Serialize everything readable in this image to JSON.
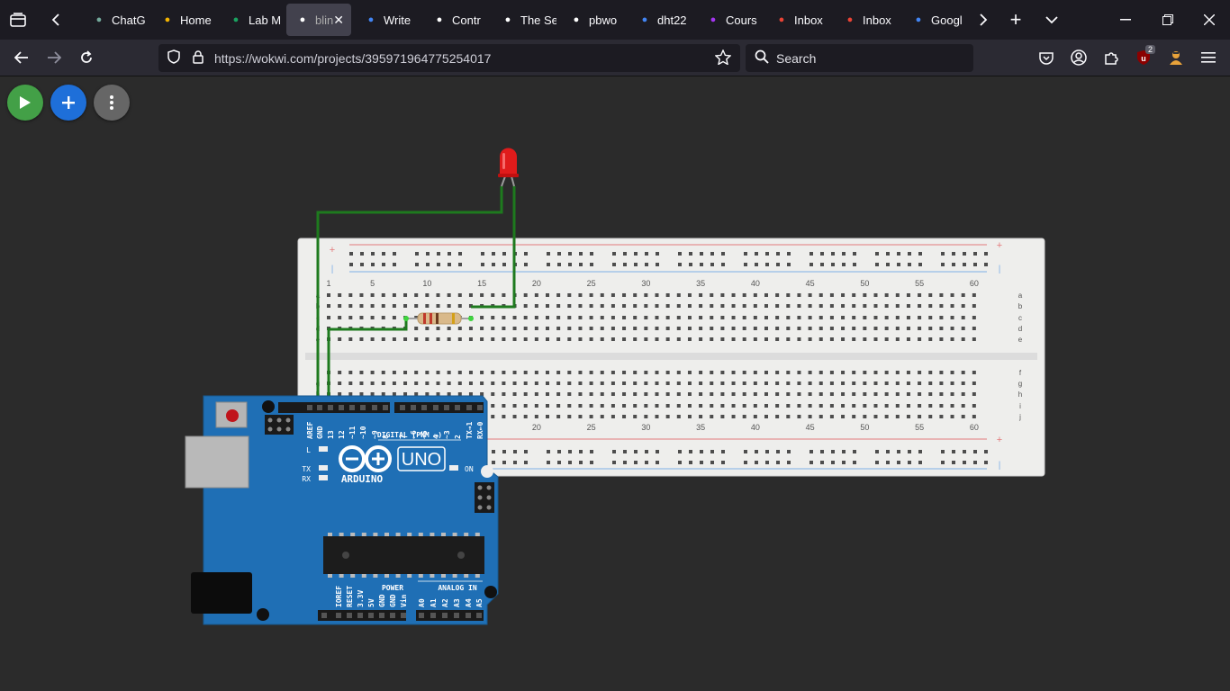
{
  "browser": {
    "tabs": [
      {
        "label": "ChatG",
        "icon": "chatgpt-icon",
        "color": "#74aa9c"
      },
      {
        "label": "Home",
        "icon": "home-icon",
        "color": "#f4b400"
      },
      {
        "label": "Lab M",
        "icon": "classroom-icon",
        "color": "#1aa260"
      },
      {
        "label": "blin",
        "icon": "wokwi-icon",
        "color": "#ffffff",
        "active": true
      },
      {
        "label": "Write",
        "icon": "google-icon",
        "color": "#4285f4"
      },
      {
        "label": "Contr",
        "icon": "medium-icon",
        "color": "#ffffff"
      },
      {
        "label": "The Se",
        "icon": "wokwi-icon",
        "color": "#ffffff"
      },
      {
        "label": "pbwo",
        "icon": "github-icon",
        "color": "#ffffff"
      },
      {
        "label": "dht22",
        "icon": "google-icon",
        "color": "#4285f4"
      },
      {
        "label": "Cours",
        "icon": "udemy-icon",
        "color": "#a435f0"
      },
      {
        "label": "Inbox",
        "icon": "gmail-icon",
        "color": "#ea4335"
      },
      {
        "label": "Inbox",
        "icon": "gmail-icon",
        "color": "#ea4335"
      },
      {
        "label": "Googl",
        "icon": "google-icon",
        "color": "#4285f4"
      }
    ],
    "url": "https://wokwi.com/projects/395971964775254017",
    "search_placeholder": "Search",
    "extension_badge": "2"
  },
  "toolbar": {
    "colors": {
      "play": "#43a047",
      "add": "#1e6fd9",
      "more": "#666666"
    }
  },
  "circuit": {
    "colors": {
      "board": "#1f6fb5",
      "breadboard": "#eeeeec",
      "wire": "#1e7a1e",
      "led": "#e01b1b"
    },
    "breadboard": {
      "column_labels": [
        "1",
        "5",
        "10",
        "15",
        "20",
        "25",
        "30",
        "35",
        "40",
        "45",
        "50",
        "55",
        "60"
      ],
      "top_rows": [
        "a",
        "b",
        "c",
        "d",
        "e"
      ],
      "bottom_rows": [
        "f",
        "g",
        "h",
        "i",
        "j"
      ],
      "plus": "+",
      "minus": "-"
    },
    "arduino": {
      "model": "UNO",
      "brand": "ARDUINO",
      "digital_label": "DIGITAL (PWM ~)",
      "digital_pins": [
        "AREF",
        "GND",
        "13",
        "12",
        "~11",
        "~10",
        "~9",
        "8",
        "7",
        "~6",
        "~5",
        "4",
        "~3",
        "2",
        "TX→1",
        "RX←0"
      ],
      "power_pins": [
        "IOREF",
        "RESET",
        "3.3V",
        "5V",
        "GND",
        "GND",
        "Vin"
      ],
      "power_label": "POWER",
      "analog_label": "ANALOG IN",
      "analog_pins": [
        "A0",
        "A1",
        "A2",
        "A3",
        "A4",
        "A5"
      ],
      "led_labels": {
        "l": "L",
        "tx": "TX",
        "rx": "RX",
        "on": "ON"
      }
    }
  }
}
